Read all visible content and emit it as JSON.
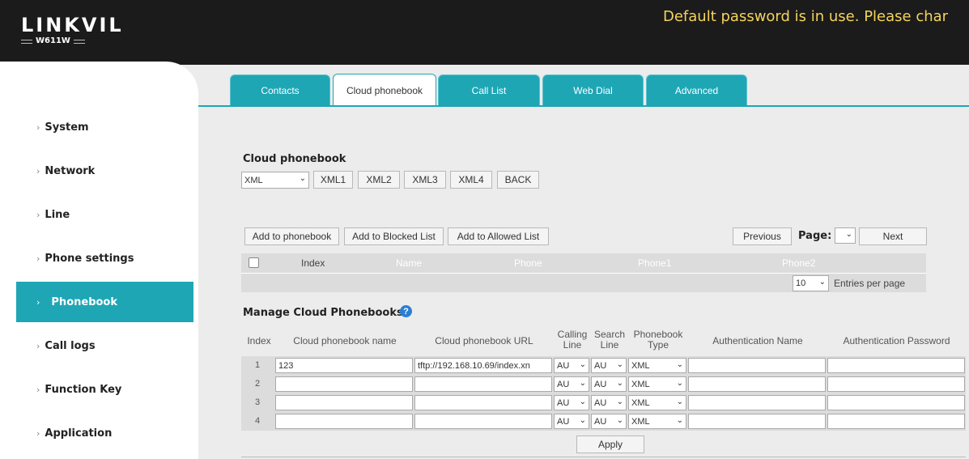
{
  "header": {
    "brand": "LINKVIL",
    "model": "W611W",
    "warning": "Default password is in use. Please char"
  },
  "sidebar": {
    "items": [
      {
        "label": "System"
      },
      {
        "label": "Network"
      },
      {
        "label": "Line"
      },
      {
        "label": "Phone settings"
      },
      {
        "label": "Phonebook"
      },
      {
        "label": "Call logs"
      },
      {
        "label": "Function Key"
      },
      {
        "label": "Application"
      }
    ],
    "active": "Phonebook"
  },
  "tabs": [
    {
      "label": "Contacts"
    },
    {
      "label": "Cloud phonebook"
    },
    {
      "label": "Call List"
    },
    {
      "label": "Web Dial"
    },
    {
      "label": "Advanced"
    }
  ],
  "cloud": {
    "title": "Cloud phonebook",
    "type_select": "XML",
    "buttons": [
      "XML1",
      "XML2",
      "XML3",
      "XML4",
      "BACK"
    ]
  },
  "actions": {
    "add_phonebook": "Add to phonebook",
    "add_blocked": "Add to Blocked List",
    "add_allowed": "Add to Allowed List",
    "previous": "Previous",
    "page_label": "Page:",
    "page_value": "",
    "next": "Next"
  },
  "list": {
    "columns": [
      "Index",
      "Name",
      "Phone",
      "Phone1",
      "Phone2"
    ],
    "per_page_value": "10",
    "per_page_label": "Entries per page"
  },
  "manage": {
    "title": "Manage Cloud Phonebooks",
    "headers": {
      "index": "Index",
      "name": "Cloud phonebook name",
      "url": "Cloud phonebook URL",
      "calling_line_1": "Calling",
      "calling_line_2": "Line",
      "search_line_1": "Search",
      "search_line_2": "Line",
      "type_1": "Phonebook",
      "type_2": "Type",
      "auth_name": "Authentication Name",
      "auth_password": "Authentication Password"
    },
    "rows": [
      {
        "index": "1",
        "name": "123",
        "url": "tftp://192.168.10.69/index.xn",
        "calling": "AU",
        "search": "AU",
        "type": "XML",
        "auth_name": "",
        "auth_password": ""
      },
      {
        "index": "2",
        "name": "",
        "url": "",
        "calling": "AU",
        "search": "AU",
        "type": "XML",
        "auth_name": "",
        "auth_password": ""
      },
      {
        "index": "3",
        "name": "",
        "url": "",
        "calling": "AU",
        "search": "AU",
        "type": "XML",
        "auth_name": "",
        "auth_password": ""
      },
      {
        "index": "4",
        "name": "",
        "url": "",
        "calling": "AU",
        "search": "AU",
        "type": "XML",
        "auth_name": "",
        "auth_password": ""
      }
    ],
    "apply": "Apply"
  },
  "colors": {
    "accent": "#1ea6b5",
    "header_bg": "#1b1b1b",
    "warning": "#f4d35e"
  }
}
